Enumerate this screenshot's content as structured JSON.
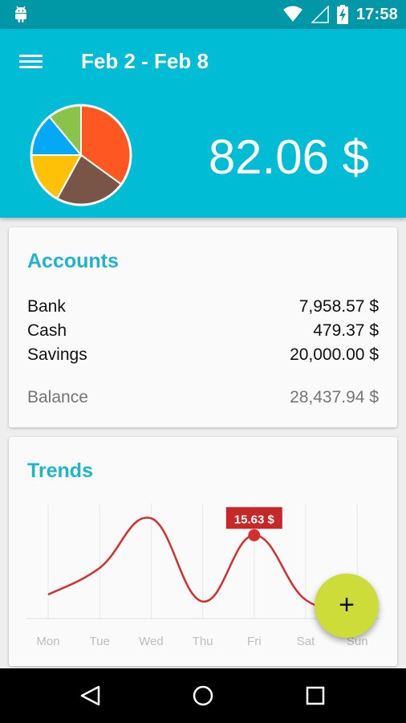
{
  "status_bar": {
    "time": "17:58"
  },
  "header": {
    "title": "Feb 2 - Feb 8",
    "total": "82.06 $"
  },
  "pie_chart": {
    "slices": [
      {
        "color": "#ff5722",
        "value": 35
      },
      {
        "color": "#795548",
        "value": 23
      },
      {
        "color": "#ffc107",
        "value": 17
      },
      {
        "color": "#03a9f4",
        "value": 14
      },
      {
        "color": "#8bc34a",
        "value": 11
      }
    ]
  },
  "accounts": {
    "title": "Accounts",
    "items": [
      {
        "name": "Bank",
        "amount": "7,958.57 $"
      },
      {
        "name": "Cash",
        "amount": "479.37 $"
      },
      {
        "name": "Savings",
        "amount": "20,000.00 $"
      }
    ],
    "balance_label": "Balance",
    "balance_amount": "28,437.94 $"
  },
  "trends": {
    "title": "Trends",
    "chart_data": {
      "type": "line",
      "categories": [
        "Mon",
        "Tue",
        "Wed",
        "Thu",
        "Fri",
        "Sat",
        "Sun"
      ],
      "values": [
        4.5,
        9.5,
        18.8,
        3.2,
        15.63,
        3.5,
        2.0
      ],
      "highlight": {
        "index": 4,
        "label": "15.63 $"
      },
      "ylim": [
        0,
        22
      ],
      "color": "#d32f2f"
    }
  },
  "fab": {
    "icon": "plus-icon",
    "color": "#cddc39"
  }
}
